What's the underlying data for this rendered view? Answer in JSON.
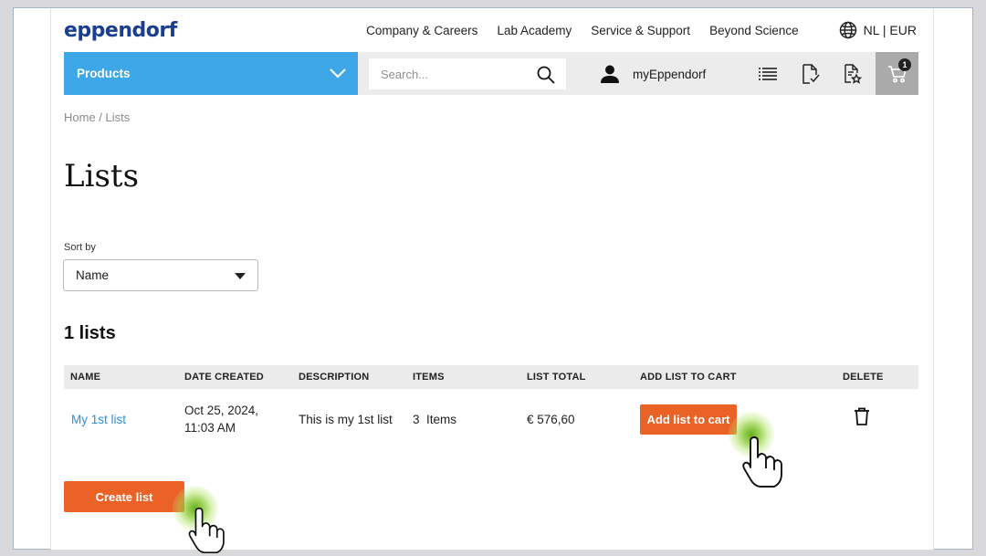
{
  "header": {
    "logo_text": "eppendorf",
    "nav_links": [
      "Company & Careers",
      "Lab Academy",
      "Service & Support",
      "Beyond Science"
    ],
    "locale": "NL | EUR"
  },
  "navbar": {
    "products_label": "Products",
    "search_placeholder": "Search...",
    "account_label": "myEppendorf",
    "cart_count": "1"
  },
  "breadcrumb": {
    "home": "Home",
    "separator": " / ",
    "current": "Lists"
  },
  "page": {
    "title": "Lists",
    "sort_label": "Sort by",
    "sort_value": "Name",
    "count_text": "1 lists"
  },
  "table": {
    "columns": [
      "NAME",
      "DATE CREATED",
      "DESCRIPTION",
      "ITEMS",
      "LIST TOTAL",
      "ADD LIST TO CART",
      "DELETE"
    ],
    "rows": [
      {
        "name": "My 1st list",
        "date_line1": "Oct 25, 2024,",
        "date_line2": "11:03 AM",
        "description": "This is my 1st list",
        "items": "3  Items",
        "total": "€ 576,60",
        "add_label": "Add list to cart"
      }
    ]
  },
  "actions": {
    "create_label": "Create list"
  },
  "colors": {
    "brand_blue": "#1b3f8f",
    "products_bg": "#3ea7e8",
    "accent_orange": "#eb6227",
    "link_blue": "#2b8fd6",
    "click_highlight": "#7cc22a"
  },
  "icons": [
    "globe-icon",
    "chevron-down-icon",
    "search-icon",
    "user-icon",
    "list-icon",
    "document-check-icon",
    "document-star-icon",
    "cart-icon",
    "trash-icon",
    "pointer-hand-icon"
  ]
}
